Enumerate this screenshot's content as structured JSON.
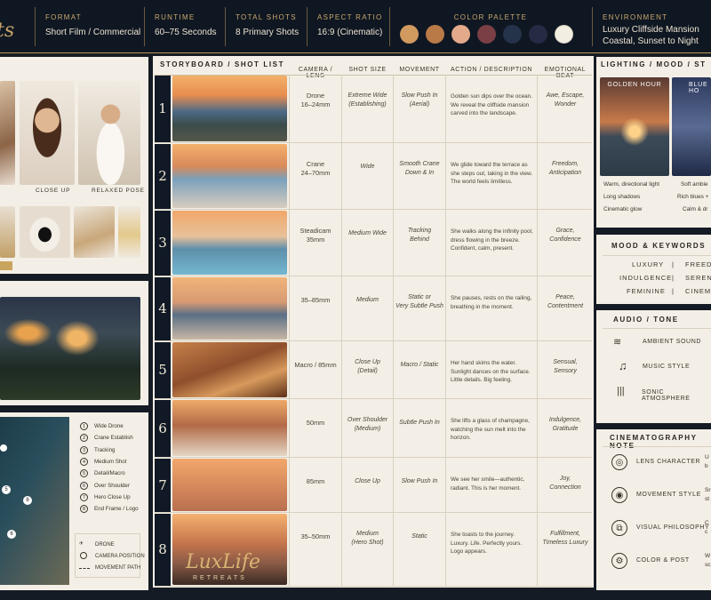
{
  "header": {
    "brand_partial": "ts",
    "format": {
      "label": "FORMAT",
      "value": "Short Film / Commercial"
    },
    "runtime": {
      "label": "RUNTIME",
      "value": "60–75 Seconds"
    },
    "total_shots": {
      "label": "TOTAL SHOTS",
      "value": "8 Primary Shots"
    },
    "aspect_ratio": {
      "label": "ASPECT RATIO",
      "value": "16:9 (Cinematic)"
    },
    "color_palette": {
      "label": "COLOR PALETTE",
      "colors": [
        "#d19a5f",
        "#b97a48",
        "#e2a98a",
        "#7a3f44",
        "#24324a",
        "#262b45",
        "#f3eee2"
      ]
    },
    "environment": {
      "label": "ENVIRONMENT",
      "line1": "Luxury Cliffside Mansion",
      "line2": "Coastal, Sunset to Night"
    }
  },
  "left": {
    "captions": [
      "CLOSE UP",
      "RELAXED POSE"
    ]
  },
  "storyboard": {
    "title": "STORYBOARD / SHOT LIST",
    "columns": [
      "CAMERA / LENS",
      "SHOT SIZE",
      "MOVEMENT",
      "ACTION / DESCRIPTION",
      "EMOTIONAL BEAT"
    ],
    "rows": [
      {
        "n": "1",
        "camera": "Drone\n16–24mm",
        "size": "Extreme Wide\n(Establishing)",
        "movement": "Slow Push In\n(Aerial)",
        "action": "Golden sun dips over the ocean. We reveal the cliffside mansion carved into the landscape.",
        "beat": "Awe, Escape,\nWonder"
      },
      {
        "n": "2",
        "camera": "Crane\n24–70mm",
        "size": "Wide",
        "movement": "Smooth Crane\nDown & In",
        "action": "We glide toward the terrace as she steps out, taking in the view. The world feels limitless.",
        "beat": "Freedom,\nAnticipation"
      },
      {
        "n": "3",
        "camera": "Steadicam\n35mm",
        "size": "Medium Wide",
        "movement": "Tracking\nBehind",
        "action": "She walks along the infinity pool, dress flowing in the breeze. Confident, calm, present.",
        "beat": "Grace,\nConfidence"
      },
      {
        "n": "4",
        "camera": "35–85mm",
        "size": "Medium",
        "movement": "Static or\nVery Subtle Push",
        "action": "She pauses, rests on the railing, breathing in the moment.",
        "beat": "Peace,\nContentment"
      },
      {
        "n": "5",
        "camera": "Macro / 85mm",
        "size": "Close Up\n(Detail)",
        "movement": "Macro / Static",
        "action": "Her hand skims the water. Sunlight dances on the surface. Little details. Big feeling.",
        "beat": "Sensual,\nSensory"
      },
      {
        "n": "6",
        "camera": "50mm",
        "size": "Over Shoulder\n(Medium)",
        "movement": "Subtle Push In",
        "action": "She lifts a glass of champagne, watching the sun melt into the horizon.",
        "beat": "Indulgence,\nGratitude"
      },
      {
        "n": "7",
        "camera": "85mm",
        "size": "Close Up",
        "movement": "Slow Push In",
        "action": "We see her smile—authentic, radiant. This is her moment.",
        "beat": "Joy,\nConnection"
      },
      {
        "n": "8",
        "camera": "35–50mm",
        "size": "Medium\n(Hero Shot)",
        "movement": "Static",
        "action": "She toasts to the journey. Luxury. Life. Perfectly yours. Logo appears.",
        "beat": "Fulfillment,\nTimeless Luxury"
      }
    ],
    "logo": {
      "name": "LuxLife",
      "sub": "RETREATS"
    }
  },
  "map": {
    "list": [
      "Wide Drone",
      "Crane Establish",
      "Tracking",
      "Medium Shot",
      "Detail/Macro",
      "Over Shoulder",
      "Hero Close Up",
      "End Frame / Logo"
    ],
    "legend": [
      "DRONE",
      "CAMERA POSITION",
      "MOVEMENT PATH"
    ],
    "markers": [
      "5",
      "8",
      "6"
    ]
  },
  "right": {
    "lighting": {
      "title": "LIGHTING / MOOD / ST",
      "golden": "GOLDEN HOUR",
      "blue": "BLUE HO",
      "golden_notes": [
        "Warm, directional light",
        "Long shadows",
        "Cinematic glow"
      ],
      "blue_notes": [
        "Soft ambie",
        "Rich blues +",
        "Calm & dr"
      ]
    },
    "mood": {
      "title": "MOOD & KEYWORDS",
      "rows": [
        [
          "LUXURY",
          "FREEDO"
        ],
        [
          "INDULGENCE",
          "SERENI"
        ],
        [
          "FEMININE",
          "CINEMA"
        ]
      ]
    },
    "audio": {
      "title": "AUDIO / TONE",
      "items": [
        "AMBIENT SOUND",
        "MUSIC STYLE",
        "SONIC ATMOSPHERE"
      ]
    },
    "cine": {
      "title": "CINEMATOGRAPHY NOTE",
      "items": [
        {
          "label": "LENS CHARACTER",
          "trail": "U\nb"
        },
        {
          "label": "MOVEMENT STYLE",
          "trail": "Sr\nst"
        },
        {
          "label": "VISUAL PHILOSOPHY",
          "trail": "C\nc"
        },
        {
          "label": "COLOR & POST",
          "trail": "W\nsc"
        }
      ]
    }
  }
}
